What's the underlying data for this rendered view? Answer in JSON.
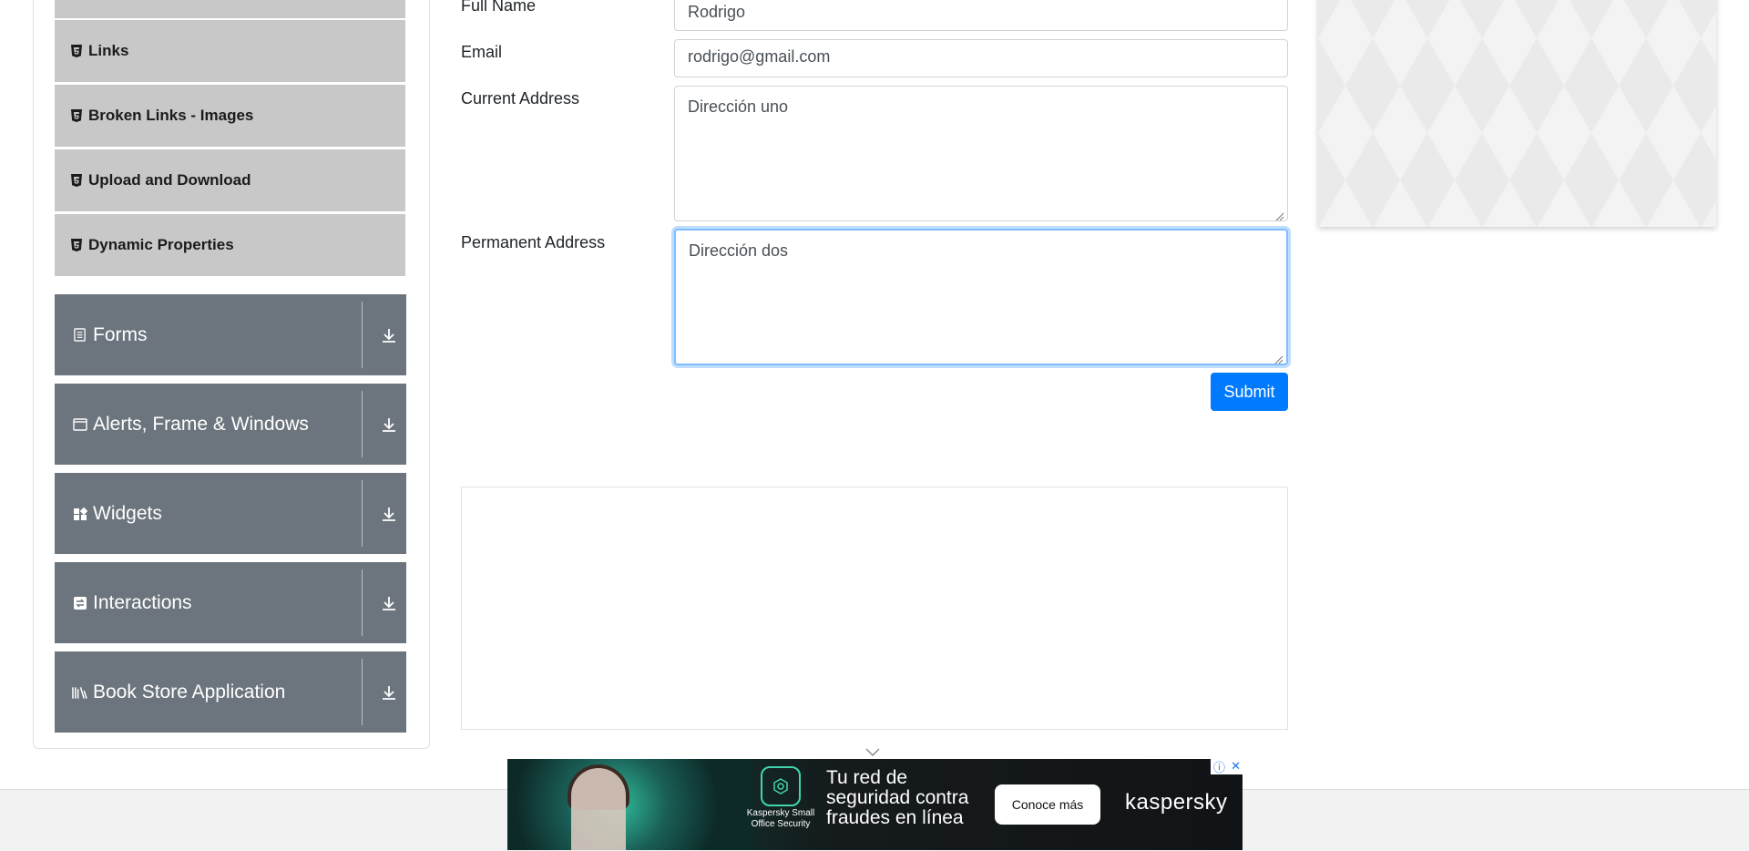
{
  "sidebar": {
    "sub_items": [
      {
        "label": "Links",
        "icon": "html5-icon"
      },
      {
        "label": "Broken Links - Images",
        "icon": "html5-icon"
      },
      {
        "label": "Upload and Download",
        "icon": "html5-icon"
      },
      {
        "label": "Dynamic Properties",
        "icon": "html5-icon"
      }
    ],
    "groups": [
      {
        "label": "Forms",
        "icon": "document-icon"
      },
      {
        "label": "Alerts, Frame & Windows",
        "icon": "window-icon"
      },
      {
        "label": "Widgets",
        "icon": "widgets-icon"
      },
      {
        "label": "Interactions",
        "icon": "interactions-icon"
      },
      {
        "label": "Book Store Application",
        "icon": "books-icon"
      }
    ]
  },
  "form": {
    "full_name_label": "Full Name",
    "full_name_value": "Rodrigo",
    "email_label": "Email",
    "email_value": "rodrigo@gmail.com",
    "current_address_label": "Current Address",
    "current_address_value": "Dirección uno",
    "permanent_address_label": "Permanent Address",
    "permanent_address_value": "Dirección dos",
    "submit_label": "Submit"
  },
  "ad": {
    "headline": "Tu red de seguridad contra fraudes en línea",
    "logo_caption": "Kaspersky Small Office Security",
    "cta_label": "Conoce más",
    "brand": "kaspersky",
    "info_symbol": "ⓘ",
    "close_symbol": "✕"
  },
  "colors": {
    "accent": "#007bff",
    "group_bg": "#6c757d",
    "sub_item_bg": "#c8c8c8"
  }
}
